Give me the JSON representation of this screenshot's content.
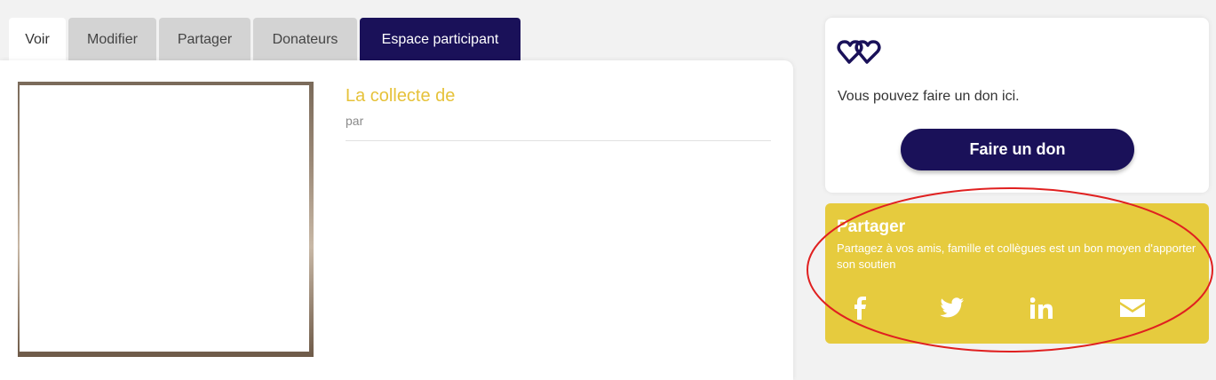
{
  "tabs": [
    {
      "label": "Voir"
    },
    {
      "label": "Modifier"
    },
    {
      "label": "Partager"
    },
    {
      "label": "Donateurs"
    },
    {
      "label": "Espace participant"
    }
  ],
  "collecte": {
    "title": "La collecte de",
    "by": "par"
  },
  "don": {
    "text": "Vous pouvez faire un don ici.",
    "button": "Faire un don"
  },
  "share": {
    "title": "Partager",
    "description": "Partagez à vos amis, famille et collègues est un bon moyen d'apporter son soutien",
    "icons": [
      "facebook-icon",
      "twitter-icon",
      "linkedin-icon",
      "mail-icon"
    ]
  },
  "colors": {
    "brand_dark": "#1a1159",
    "accent_yellow": "#e6cb3e",
    "annotation_red": "#e02020"
  }
}
